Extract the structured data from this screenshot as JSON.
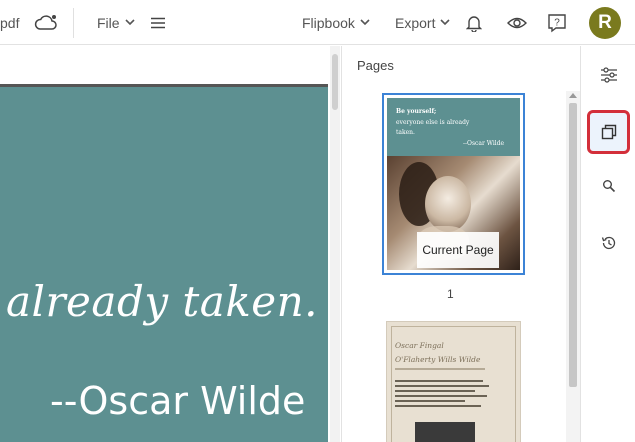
{
  "topbar": {
    "filename_fragment": "pdf",
    "file_menu": "File",
    "flipbook_menu": "Flipbook",
    "export_menu": "Export",
    "avatar_initial": "R",
    "icons": [
      "cloud-sync-icon",
      "chevron-down-icon",
      "hamburger-menu-icon",
      "bell-icon",
      "eye-icon",
      "help-icon"
    ]
  },
  "canvas": {
    "line1": "already taken.",
    "line2": "--Oscar Wilde",
    "background_color": "#5d9091"
  },
  "pages_panel": {
    "title": "Pages",
    "pages": [
      {
        "number": "1",
        "current_label": "Current Page",
        "quote_lines": [
          "Be yourself;",
          "everyone else is already",
          "taken.",
          "--Oscar Wilde"
        ]
      },
      {
        "title_line1": "Oscar Fingal",
        "title_line2": "O'Flaherty Wills Wilde"
      }
    ]
  },
  "rail": {
    "items": [
      "settings-sliders-icon",
      "pages-icon",
      "search-icon",
      "history-icon"
    ],
    "active": "pages-icon",
    "active_color": "#d32f3a"
  }
}
